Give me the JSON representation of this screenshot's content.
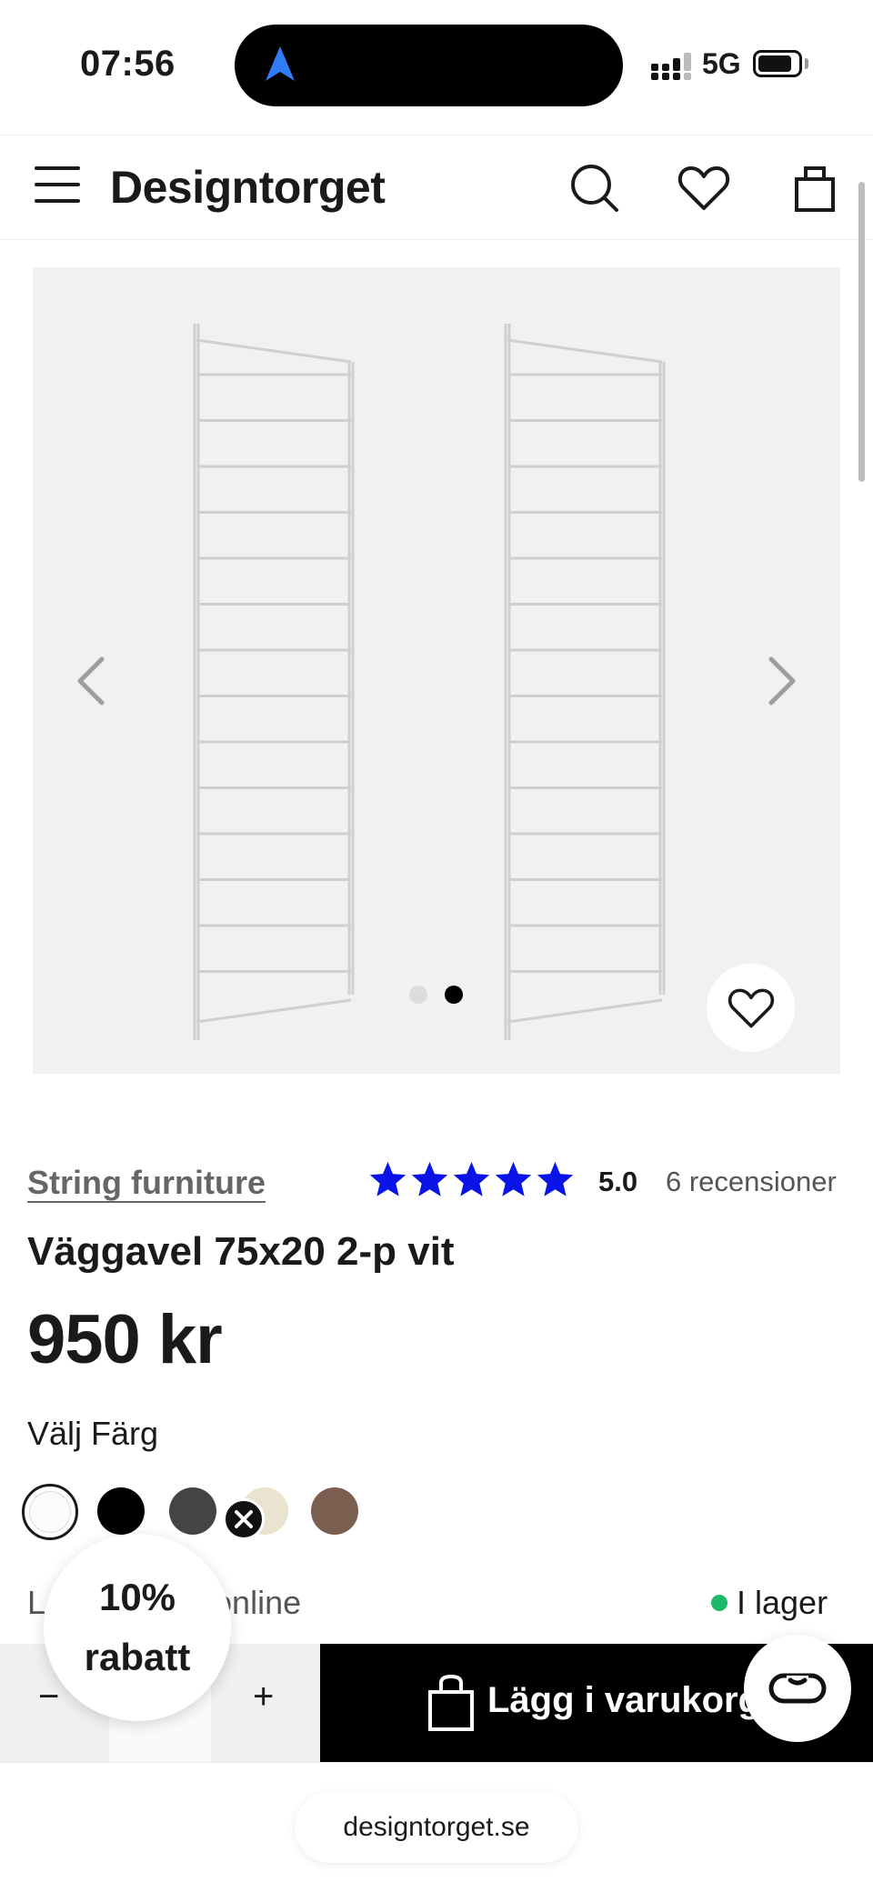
{
  "status_bar": {
    "time": "07:56",
    "network": "5G"
  },
  "header": {
    "logo": "Designtorget"
  },
  "gallery": {
    "slide_index": 2,
    "slide_count": 2
  },
  "product": {
    "brand": "String furniture",
    "rating_value": "5.0",
    "rating_stars": 5,
    "reviews": "6 recensioner",
    "title": "Väggavel 75x20 2-p vit",
    "price": "950 kr",
    "color_label": "Välj Färg",
    "colors": [
      "#fbfbfb",
      "#000000",
      "#444444",
      "#e9e3cf",
      "#7a5e50"
    ],
    "availability": "L",
    "availability_suffix": "onl",
    "availability_suffix2": "ine",
    "stock": "I lager",
    "stock_color": "#1fb86a"
  },
  "purchase": {
    "minus": "−",
    "plus": "+",
    "add_to_cart": "Lägg i varukorge"
  },
  "discount": {
    "line1": "10%",
    "line2": "rabatt"
  },
  "browser": {
    "url": "designtorget.se"
  }
}
